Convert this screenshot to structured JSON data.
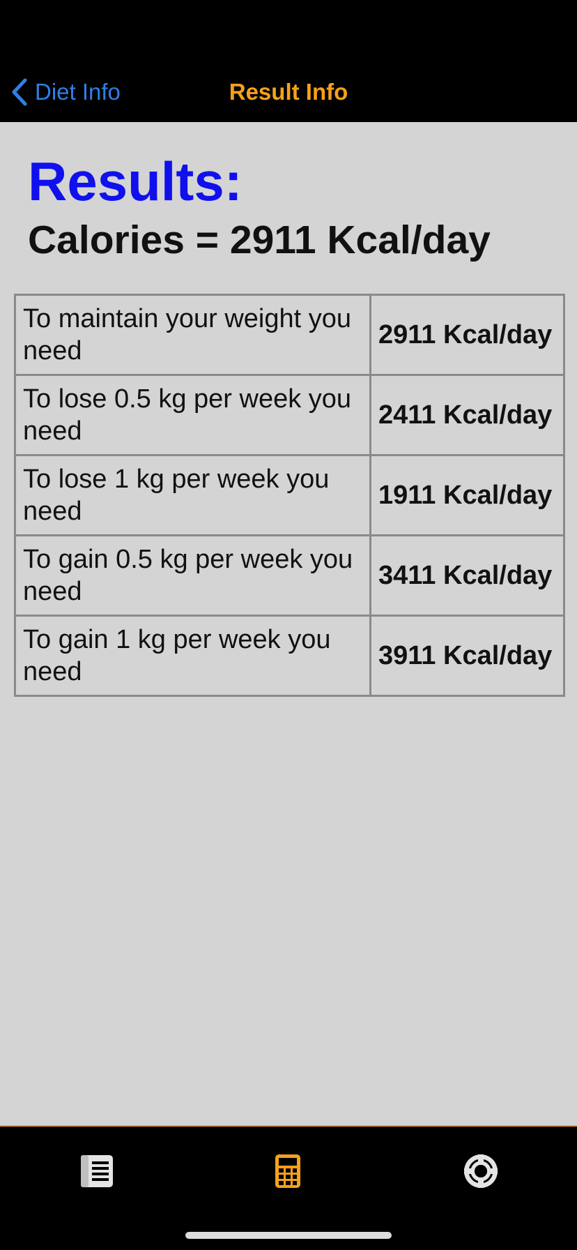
{
  "nav": {
    "back_label": "Diet Info",
    "title": "Result Info"
  },
  "results": {
    "heading": "Results:",
    "calories_line": "Calories = 2911 Kcal/day"
  },
  "table": {
    "rows": [
      {
        "label": "To maintain your weight you need",
        "value": "2911 Kcal/day"
      },
      {
        "label": "To lose 0.5 kg per week you need",
        "value": "2411 Kcal/day"
      },
      {
        "label": "To lose 1 kg per week you need",
        "value": "1911 Kcal/day"
      },
      {
        "label": "To gain 0.5 kg per week you need",
        "value": "3411 Kcal/day"
      },
      {
        "label": "To gain 1 kg per week you need",
        "value": "3911 Kcal/day"
      }
    ]
  },
  "tabs": [
    {
      "icon": "news-icon",
      "selected": false
    },
    {
      "icon": "calculator-icon",
      "selected": true
    },
    {
      "icon": "lifebuoy-icon",
      "selected": false
    }
  ],
  "colors": {
    "accent_orange": "#f5a11a",
    "link_blue": "#2f7fe6",
    "heading_blue": "#1010ee",
    "background": "#d4d4d4",
    "bar_background": "#000000",
    "inactive_icon": "#e4e4e4"
  }
}
